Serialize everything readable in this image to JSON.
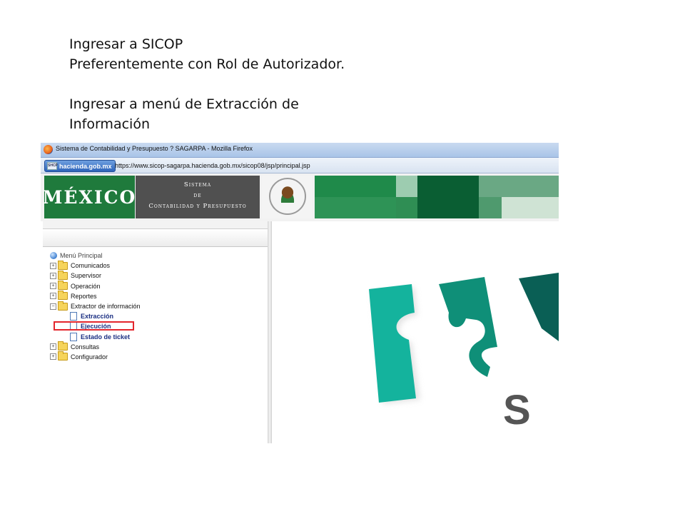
{
  "instructions": {
    "line1": "Ingresar a SICOP",
    "line2": "Preferentemente con Rol de Autorizador.",
    "line3": "Ingresar a menú de Extracción de",
    "line4": "Información"
  },
  "browser": {
    "title": "Sistema de Contabilidad y Presupuesto ? SAGARPA - Mozilla Firefox",
    "site_badge": "hacienda.gob.mx",
    "url": "https://www.sicop-sagarpa.hacienda.gob.mx/sicop08/jsp/principal.jsp",
    "icon": "firefox-icon"
  },
  "banner": {
    "mexico": "MÉXICO",
    "system_line1": "Sistema",
    "system_line2": "de",
    "system_line3": "Contabilidad y Presupuesto",
    "colors": {
      "green": "#1f7a3c",
      "gray": "#505050"
    }
  },
  "menu": {
    "root": "Menú Principal",
    "items": [
      {
        "label": "Comunicados"
      },
      {
        "label": "Supervisor"
      },
      {
        "label": "Operación"
      },
      {
        "label": "Reportes"
      },
      {
        "label": "Extractor de información"
      }
    ],
    "children": [
      {
        "label": "Extracción"
      },
      {
        "label": "Ejecución"
      },
      {
        "label": "Estado de ticket"
      }
    ],
    "after": [
      {
        "label": "Consultas"
      },
      {
        "label": "Configurador"
      }
    ],
    "highlight_color": "#e3262d"
  },
  "logo": {
    "text": "S I",
    "colors": {
      "teal": "#14b39d",
      "mid": "#0f8f78",
      "dark": "#0a5f55"
    }
  }
}
